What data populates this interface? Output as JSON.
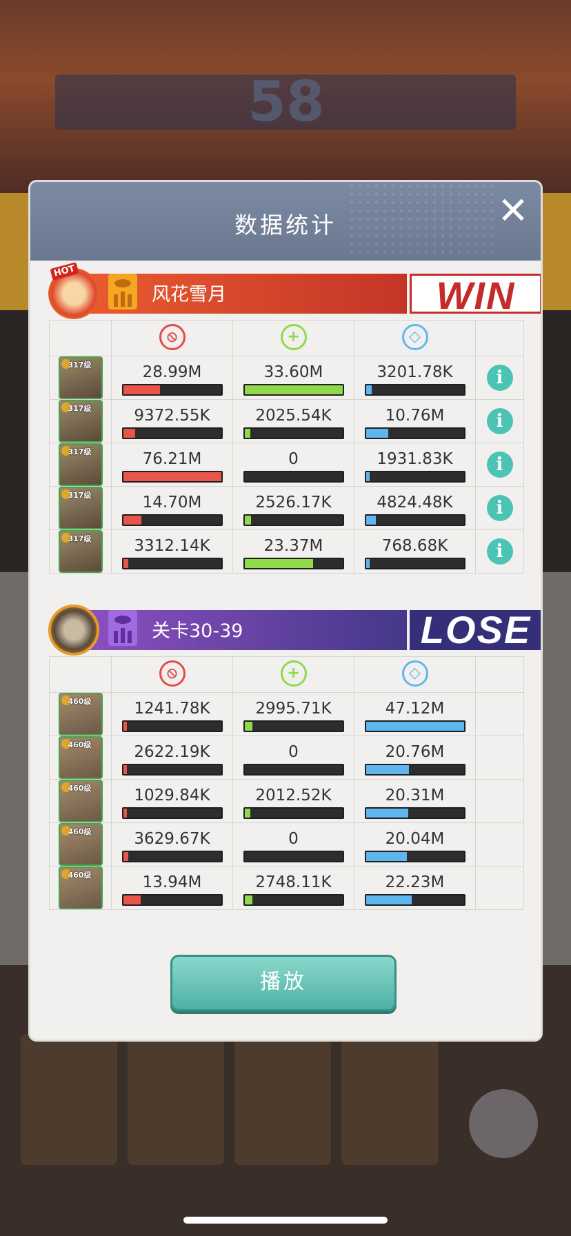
{
  "modal": {
    "title": "数据统计",
    "close_label": "✕",
    "play_label": "播放"
  },
  "team1": {
    "name": "风花雪月",
    "result": "WIN",
    "hot": "HOT",
    "heroes": [
      {
        "level": "317级",
        "dmg": "28.99M",
        "dmg_ratio": 0.38,
        "heal": "33.60M",
        "heal_ratio": 1.0,
        "def": "3201.78K",
        "def_ratio": 0.06
      },
      {
        "level": "317级",
        "dmg": "9372.55K",
        "dmg_ratio": 0.12,
        "heal": "2025.54K",
        "heal_ratio": 0.06,
        "def": "10.76M",
        "def_ratio": 0.23
      },
      {
        "level": "317级",
        "dmg": "76.21M",
        "dmg_ratio": 1.0,
        "heal": "0",
        "heal_ratio": 0,
        "def": "1931.83K",
        "def_ratio": 0.04
      },
      {
        "level": "317级",
        "dmg": "14.70M",
        "dmg_ratio": 0.19,
        "heal": "2526.17K",
        "heal_ratio": 0.07,
        "def": "4824.48K",
        "def_ratio": 0.1
      },
      {
        "level": "317级",
        "dmg": "3312.14K",
        "dmg_ratio": 0.05,
        "heal": "23.37M",
        "heal_ratio": 0.7,
        "def": "768.68K",
        "def_ratio": 0.02
      }
    ]
  },
  "team2": {
    "name": "关卡30-39",
    "result": "LOSE",
    "heroes": [
      {
        "level": "460级",
        "dmg": "1241.78K",
        "dmg_ratio": 0.02,
        "heal": "2995.71K",
        "heal_ratio": 0.08,
        "def": "47.12M",
        "def_ratio": 1.0
      },
      {
        "level": "460级",
        "dmg": "2622.19K",
        "dmg_ratio": 0.04,
        "heal": "0",
        "heal_ratio": 0,
        "def": "20.76M",
        "def_ratio": 0.44
      },
      {
        "level": "460级",
        "dmg": "1029.84K",
        "dmg_ratio": 0.02,
        "heal": "2012.52K",
        "heal_ratio": 0.06,
        "def": "20.31M",
        "def_ratio": 0.43
      },
      {
        "level": "460级",
        "dmg": "3629.67K",
        "dmg_ratio": 0.05,
        "heal": "0",
        "heal_ratio": 0,
        "def": "20.04M",
        "def_ratio": 0.42
      },
      {
        "level": "460级",
        "dmg": "13.94M",
        "dmg_ratio": 0.18,
        "heal": "2748.11K",
        "heal_ratio": 0.08,
        "def": "22.23M",
        "def_ratio": 0.47
      }
    ]
  },
  "colors": {
    "damage": "#e8554a",
    "heal": "#8fd94a",
    "defense": "#5fb6ee",
    "info": "#4cc4b4",
    "win": "#c42c2a",
    "lose": "#352f7a"
  },
  "icons": {
    "damage": "sword-circle-icon",
    "heal": "plus-circle-icon",
    "defense": "shield-icon",
    "info": "info-icon"
  }
}
